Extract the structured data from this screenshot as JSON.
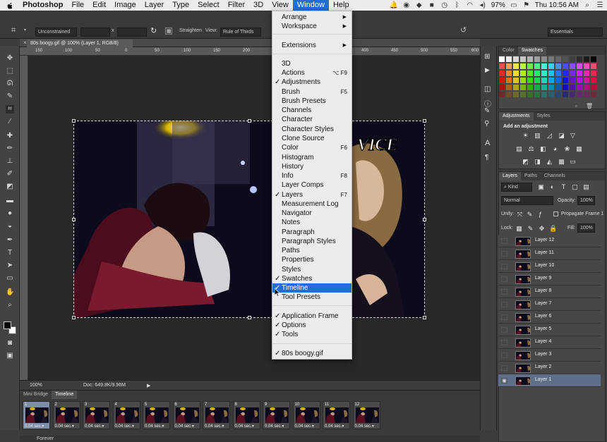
{
  "menubar": {
    "app_name": "Photoshop",
    "items": [
      "File",
      "Edit",
      "Image",
      "Layer",
      "Type",
      "Select",
      "Filter",
      "3D",
      "View",
      "Window",
      "Help"
    ],
    "battery": "97%",
    "clock": "Thu 10:56 AM"
  },
  "options_bar": {
    "ratio": "Unconstrained",
    "times": "x",
    "straighten": "Straighten",
    "view_label": "View:",
    "view_value": "Rule of Thirds",
    "workspace": "Essentials"
  },
  "document": {
    "tab_title": "80s boogy.gif @ 100% (Layer 1, RGB/8)",
    "ruler_ticks": [
      "150",
      "100",
      "50",
      "0",
      "50",
      "100",
      "150",
      "200",
      "250",
      "300",
      "350",
      "400",
      "450",
      "500",
      "550",
      "600"
    ],
    "zoom": "100%",
    "doc_size": "Doc: 649.8K/9.96M",
    "watermark": "VICE"
  },
  "window_menu": {
    "rows": [
      {
        "label": "Arrange",
        "submenu": true
      },
      {
        "label": "Workspace",
        "submenu": true
      },
      {
        "sep": true
      },
      {
        "label": "Extensions",
        "submenu": true
      },
      {
        "sep": true
      },
      {
        "label": "3D"
      },
      {
        "label": "Actions",
        "shortcut": "⌥ F9"
      },
      {
        "label": "Adjustments",
        "checked": true
      },
      {
        "label": "Brush",
        "shortcut": "F5"
      },
      {
        "label": "Brush Presets"
      },
      {
        "label": "Channels"
      },
      {
        "label": "Character"
      },
      {
        "label": "Character Styles"
      },
      {
        "label": "Clone Source"
      },
      {
        "label": "Color",
        "shortcut": "F6"
      },
      {
        "label": "Histogram"
      },
      {
        "label": "History"
      },
      {
        "label": "Info",
        "shortcut": "F8"
      },
      {
        "label": "Layer Comps"
      },
      {
        "label": "Layers",
        "checked": true,
        "shortcut": "F7"
      },
      {
        "label": "Measurement Log"
      },
      {
        "label": "Navigator"
      },
      {
        "label": "Notes"
      },
      {
        "label": "Paragraph"
      },
      {
        "label": "Paragraph Styles"
      },
      {
        "label": "Paths"
      },
      {
        "label": "Properties"
      },
      {
        "label": "Styles"
      },
      {
        "label": "Swatches",
        "checked": true
      },
      {
        "label": "Timeline",
        "checked": true,
        "highlighted": true
      },
      {
        "label": "Tool Presets"
      },
      {
        "sep": true
      },
      {
        "label": "Application Frame",
        "checked": true
      },
      {
        "label": "Options",
        "checked": true
      },
      {
        "label": "Tools",
        "checked": true
      },
      {
        "sep": true
      },
      {
        "label": "80s boogy.gif",
        "checked": true
      }
    ]
  },
  "swatches_panel": {
    "tabs": [
      "Color",
      "Swatches"
    ],
    "active_tab": "Swatches"
  },
  "adjustments_panel": {
    "tabs": [
      "Adjustments",
      "Styles"
    ],
    "heading": "Add an adjustment"
  },
  "layers_panel": {
    "tabs": [
      "Layers",
      "Paths",
      "Channels"
    ],
    "kind": "Kind",
    "blend_mode": "Normal",
    "opacity_label": "Opacity:",
    "opacity": "100%",
    "unify_label": "Unify:",
    "propagate": "Propagate Frame 1",
    "lock_label": "Lock:",
    "fill_label": "Fill:",
    "fill": "100%",
    "layers": [
      "Layer 12",
      "Layer 11",
      "Layer 10",
      "Layer 9",
      "Layer 8",
      "Layer 7",
      "Layer 6",
      "Layer 5",
      "Layer 4",
      "Layer 3",
      "Layer 2",
      "Layer 1"
    ],
    "selected": "Layer 1"
  },
  "timeline": {
    "tabs": [
      "Mini Bridge",
      "Timeline"
    ],
    "active_tab": "Timeline",
    "frames": [
      {
        "num": "1",
        "delay": "0.04 sec.▾"
      },
      {
        "num": "2",
        "delay": "0.04 sec.▾"
      },
      {
        "num": "3",
        "delay": "0.04 sec.▾"
      },
      {
        "num": "4",
        "delay": "0.04 sec.▾"
      },
      {
        "num": "5",
        "delay": "0.04 sec.▾"
      },
      {
        "num": "6",
        "delay": "0.04 sec.▾"
      },
      {
        "num": "7",
        "delay": "0.04 sec.▾"
      },
      {
        "num": "8",
        "delay": "0.04 sec.▾"
      },
      {
        "num": "9",
        "delay": "0.04 sec.▾"
      },
      {
        "num": "10",
        "delay": "0.04 sec.▾"
      },
      {
        "num": "11",
        "delay": "0.04 sec.▾"
      },
      {
        "num": "12",
        "delay": "0.04 sec.▾"
      }
    ],
    "loop": "Forever"
  },
  "colors": {
    "menu_highlight": "#1f6fd6",
    "layer_selected": "#5f6f89"
  }
}
